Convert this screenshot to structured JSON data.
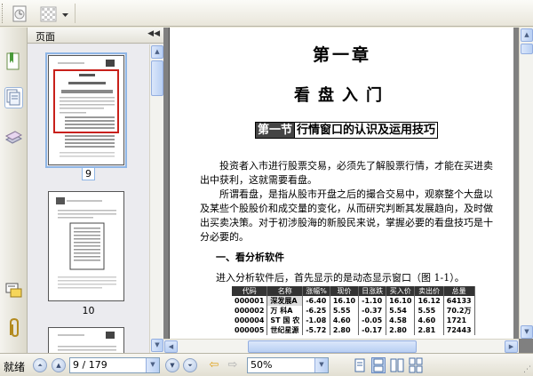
{
  "toolbar": {
    "icons": [
      "history-icon",
      "grid-pattern-icon",
      "dropdown-arrow-icon"
    ]
  },
  "strip": {
    "icons": [
      "bookmarks-icon",
      "pages-icon",
      "layers-icon",
      "comments-icon",
      "attachments-icon"
    ]
  },
  "panel": {
    "title": "页面",
    "collapse_icon": "◀◀",
    "thumbnails": [
      {
        "label": "9",
        "selected": true
      },
      {
        "label": "10",
        "selected": false
      }
    ]
  },
  "document": {
    "chapter": "第一章",
    "heading": "看盘入门",
    "section_number": "第一节",
    "section_title": "行情窗口的认识及运用技巧",
    "paragraph1": "　　投资者入市进行股票交易，必须先了解股票行情，才能在买进卖出中获利，这就需要看盘。",
    "paragraph2": "　　所谓看盘，是指从股市开盘之后的撮合交易中，观察整个大盘以及某些个股股价和成交量的变化，从而研究判断其发展趋向，及时做出买卖决策。对于初涉股海的新股民来说，掌握必要的看盘技巧是十分必要的。",
    "subhead": "一、看分析软件",
    "intro": "进入分析软件后，首先显示的是动态显示窗口（图 1-1）。",
    "table": {
      "headers": [
        "代码",
        "名称",
        "涨幅%",
        "现价",
        "日涨跌",
        "买入价",
        "卖出价",
        "总量"
      ],
      "rows": [
        [
          "000001",
          "深发展A",
          "-6.40",
          "16.10",
          "-1.10",
          "16.10",
          "16.12",
          "64133"
        ],
        [
          "000002",
          "万 科A",
          "-6.25",
          "5.55",
          "-0.37",
          "5.54",
          "5.55",
          "70.2万"
        ],
        [
          "000004",
          "ST 国 农",
          "-1.08",
          "4.60",
          "-0.05",
          "4.58",
          "4.60",
          "1721"
        ],
        [
          "000005",
          "世纪星源",
          "-5.72",
          "2.80",
          "-0.17",
          "2.80",
          "2.81",
          "72443"
        ]
      ]
    }
  },
  "status": {
    "label": "就绪",
    "page_field": "9 / 179",
    "zoom_field": "50%",
    "nav_icons": [
      "first-page-icon",
      "previous-page-icon",
      "next-page-icon",
      "last-page-icon",
      "back-icon",
      "forward-icon"
    ],
    "view_icons": [
      "single-page-view-icon",
      "continuous-view-icon",
      "facing-view-icon",
      "continuous-facing-view-icon"
    ]
  },
  "colors": {
    "highlight": "#c8201a",
    "selection": "#8fb6e6",
    "accent": "#93aee0"
  }
}
